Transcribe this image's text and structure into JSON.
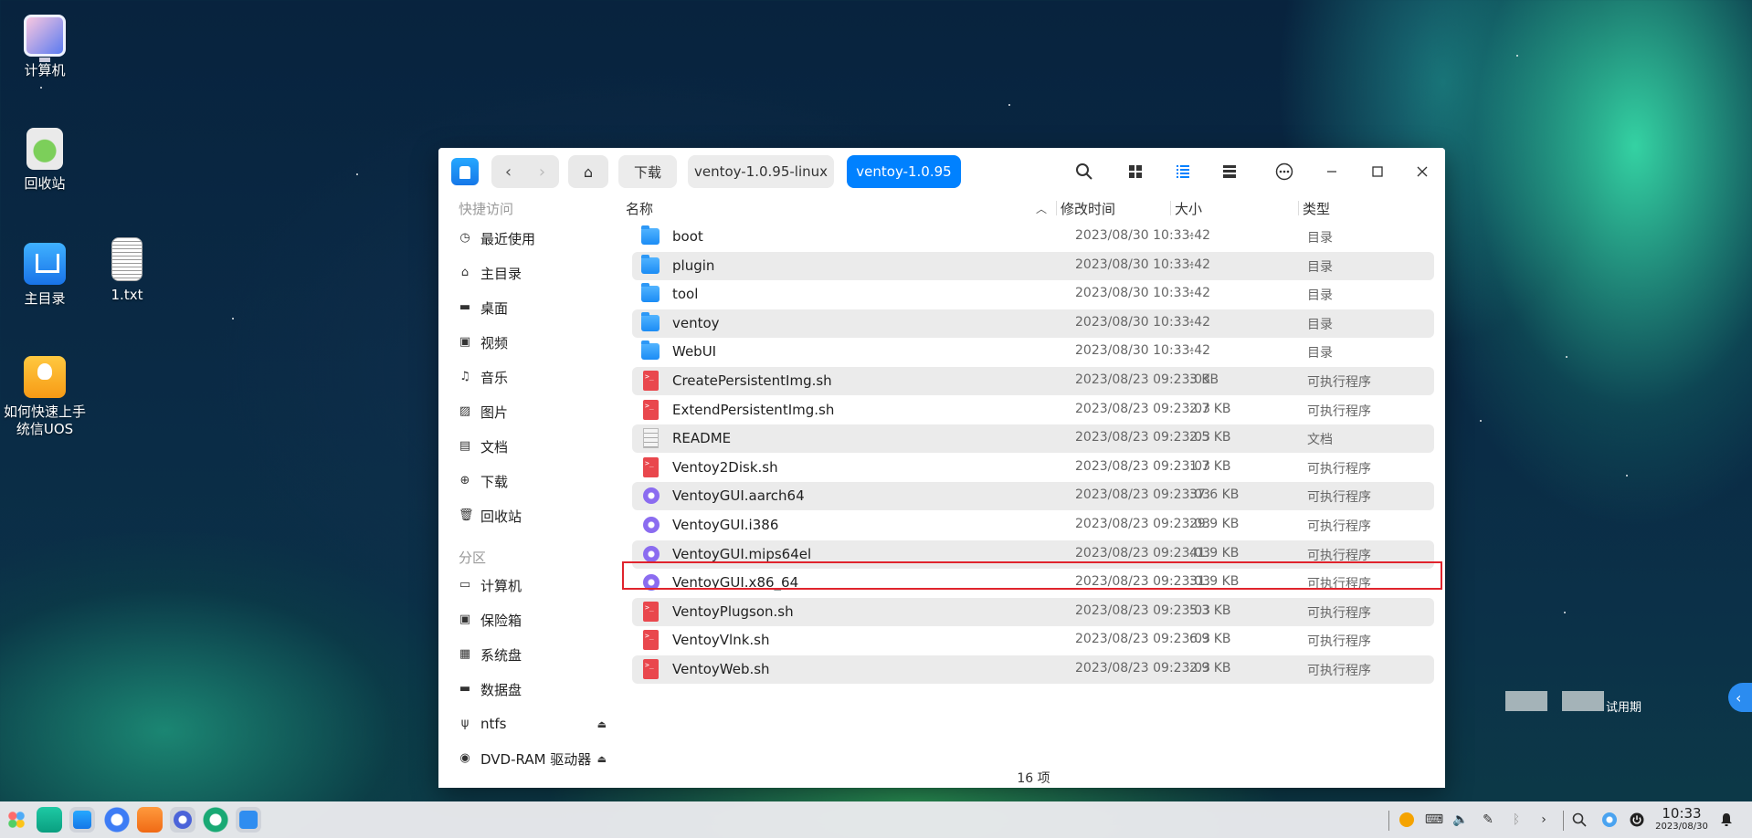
{
  "desktop": {
    "icons": [
      {
        "label": "计算机"
      },
      {
        "label": "回收站"
      },
      {
        "label": "主目录"
      },
      {
        "label": "1.txt"
      },
      {
        "label": "如何快速上手统信UOS"
      }
    ],
    "trial_label": "试用期"
  },
  "window": {
    "breadcrumbs": [
      "下载",
      "ventoy-1.0.95-linux",
      "ventoy-1.0.95"
    ],
    "sidebar": {
      "quick_title": "快捷访问",
      "quick_items": [
        "最近使用",
        "主目录",
        "桌面",
        "视频",
        "音乐",
        "图片",
        "文档",
        "下载",
        "回收站"
      ],
      "partition_title": "分区",
      "partition_items": [
        "计算机",
        "保险箱",
        "系统盘",
        "数据盘",
        "ntfs",
        "DVD-RAM 驱动器"
      ]
    },
    "columns": {
      "name": "名称",
      "modified": "修改时间",
      "size": "大小",
      "type": "类型"
    },
    "files": [
      {
        "name": "boot",
        "modified": "2023/08/30 10:33:42",
        "size": "-",
        "type": "目录",
        "icon": "folder-icon"
      },
      {
        "name": "plugin",
        "modified": "2023/08/30 10:33:42",
        "size": "-",
        "type": "目录",
        "icon": "folder-icon"
      },
      {
        "name": "tool",
        "modified": "2023/08/30 10:33:42",
        "size": "-",
        "type": "目录",
        "icon": "folder-icon"
      },
      {
        "name": "ventoy",
        "modified": "2023/08/30 10:33:42",
        "size": "-",
        "type": "目录",
        "icon": "folder-icon"
      },
      {
        "name": "WebUI",
        "modified": "2023/08/30 10:33:42",
        "size": "-",
        "type": "目录",
        "icon": "folder-icon"
      },
      {
        "name": "CreatePersistentImg.sh",
        "modified": "2023/08/23 09:23:03",
        "size": "3 KB",
        "type": "可执行程序",
        "icon": "shell-script-icon"
      },
      {
        "name": "ExtendPersistentImg.sh",
        "modified": "2023/08/23 09:23:03",
        "size": "2.7 KB",
        "type": "可执行程序",
        "icon": "shell-script-icon"
      },
      {
        "name": "README",
        "modified": "2023/08/23 09:23:03",
        "size": "2.5 KB",
        "type": "文档",
        "icon": "document-icon"
      },
      {
        "name": "Ventoy2Disk.sh",
        "modified": "2023/08/23 09:23:03",
        "size": "1.7 KB",
        "type": "可执行程序",
        "icon": "shell-script-icon"
      },
      {
        "name": "VentoyGUI.aarch64",
        "modified": "2023/08/23 09:23:03",
        "size": "37.6 KB",
        "type": "可执行程序",
        "icon": "binary-executable-icon"
      },
      {
        "name": "VentoyGUI.i386",
        "modified": "2023/08/23 09:23:03",
        "size": "29.9 KB",
        "type": "可执行程序",
        "icon": "binary-executable-icon"
      },
      {
        "name": "VentoyGUI.mips64el",
        "modified": "2023/08/23 09:23:03",
        "size": "41.9 KB",
        "type": "可执行程序",
        "icon": "binary-executable-icon"
      },
      {
        "name": "VentoyGUI.x86_64",
        "modified": "2023/08/23 09:23:03",
        "size": "31.9 KB",
        "type": "可执行程序",
        "icon": "binary-executable-icon"
      },
      {
        "name": "VentoyPlugson.sh",
        "modified": "2023/08/23 09:23:03",
        "size": "5.3 KB",
        "type": "可执行程序",
        "icon": "shell-script-icon"
      },
      {
        "name": "VentoyVlnk.sh",
        "modified": "2023/08/23 09:23:03",
        "size": "6.9 KB",
        "type": "可执行程序",
        "icon": "shell-script-icon"
      },
      {
        "name": "VentoyWeb.sh",
        "modified": "2023/08/23 09:23:03",
        "size": "2.9 KB",
        "type": "可执行程序",
        "icon": "shell-script-icon"
      }
    ],
    "item_count": "16 项",
    "accent_color": "#0081ff",
    "highlight_color": "#e0242d"
  },
  "taskbar": {
    "time": "10:33",
    "date": "2023/08/30"
  }
}
